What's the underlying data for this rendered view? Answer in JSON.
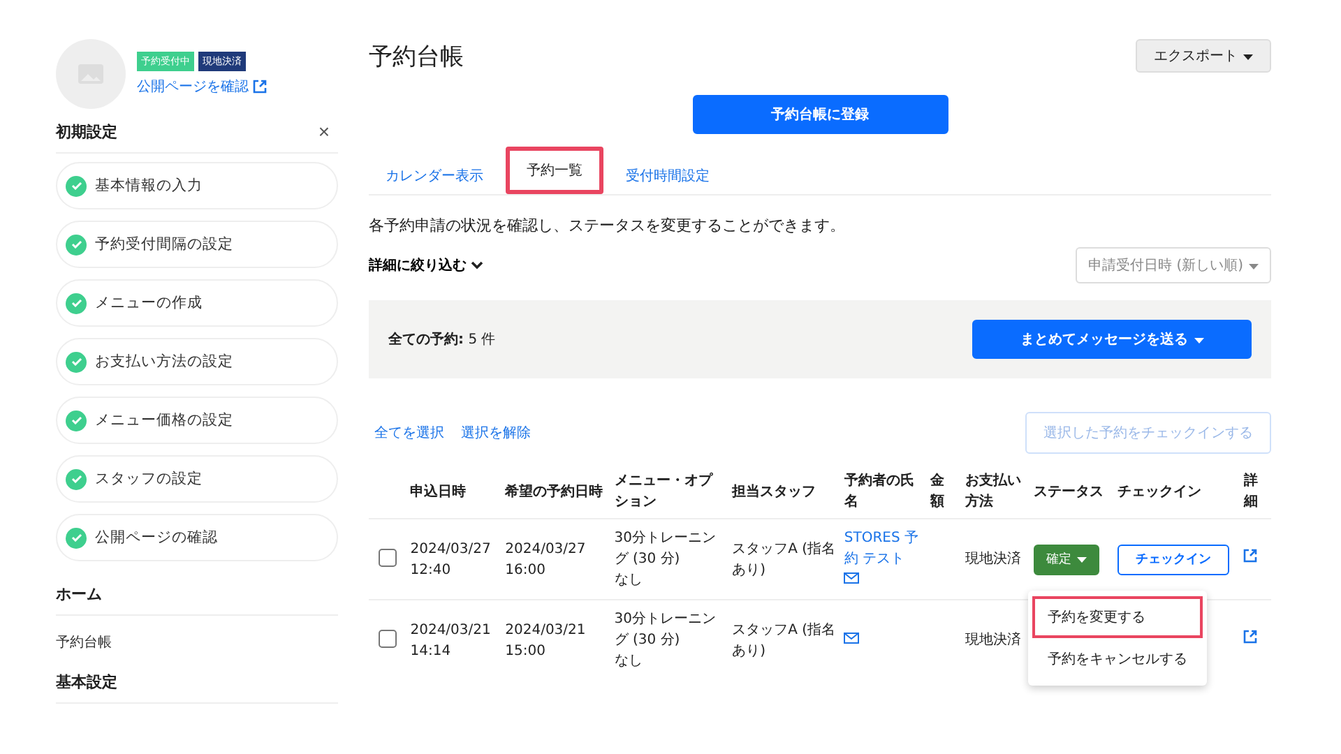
{
  "sidebar": {
    "badges": [
      {
        "label": "予約受付中",
        "color": "#3ecf8e"
      },
      {
        "label": "現地決済",
        "color": "#1f3a7a"
      }
    ],
    "public_link": "公開ページを確認",
    "setup": {
      "title": "初期設定",
      "close": "×",
      "items": [
        {
          "label": "基本情報の入力",
          "done": true
        },
        {
          "label": "予約受付間隔の設定",
          "done": true
        },
        {
          "label": "メニューの作成",
          "done": true
        },
        {
          "label": "お支払い方法の設定",
          "done": true
        },
        {
          "label": "メニュー価格の設定",
          "done": true
        },
        {
          "label": "スタッフの設定",
          "done": true
        },
        {
          "label": "公開ページの確認",
          "done": true
        }
      ]
    },
    "sections": [
      {
        "title": "ホーム",
        "items": [
          "予約台帳"
        ]
      },
      {
        "title": "基本設定"
      }
    ]
  },
  "page_title": "予約台帳",
  "export_button": "エクスポート",
  "register_button": "予約台帳に登録",
  "tabs": [
    {
      "label": "カレンダー表示",
      "selected": false
    },
    {
      "label": "予約一覧",
      "selected": true
    },
    {
      "label": "受付時間設定",
      "selected": false
    }
  ],
  "description": "各予約申請の状況を確認し、ステータスを変更することができます。",
  "filter_toggle": "詳細に絞り込む",
  "sort_select": "申請受付日時 (新しい順)",
  "summary": {
    "label": "全ての予約:",
    "count": "5 件",
    "message_button": "まとめてメッセージを送る"
  },
  "select_all": "全てを選択",
  "deselect": "選択を解除",
  "bulk_checkin": "選択した予約をチェックインする",
  "table": {
    "columns": [
      "申込日時",
      "希望の予約日時",
      "メニュー・オプション",
      "担当スタッフ",
      "予約者の氏名",
      "金額",
      "お支払い方法",
      "ステータス",
      "チェックイン",
      "詳細"
    ],
    "rows": [
      {
        "checked": false,
        "applied": [
          "2024/03/27",
          "12:40"
        ],
        "desired": [
          "2024/03/27",
          "16:00"
        ],
        "menu": [
          "30分トレーニング (30 分)",
          "なし"
        ],
        "staff": "スタッフA (指名あり)",
        "name": "STORES 予約 テスト",
        "payment": "現地決済",
        "status": "確定",
        "checkin": "チェックイン"
      },
      {
        "checked": false,
        "applied": [
          "2024/03/21",
          "14:14"
        ],
        "desired": [
          "2024/03/21",
          "15:00"
        ],
        "menu": [
          "30分トレーニング (30 分)",
          "なし"
        ],
        "staff": "スタッフA (指名あり)",
        "payment": "現地決済"
      }
    ]
  },
  "status_menu": {
    "items": [
      {
        "label": "予約を変更する",
        "highlighted": true
      },
      {
        "label": "予約をキャンセルする",
        "highlighted": false
      }
    ]
  }
}
